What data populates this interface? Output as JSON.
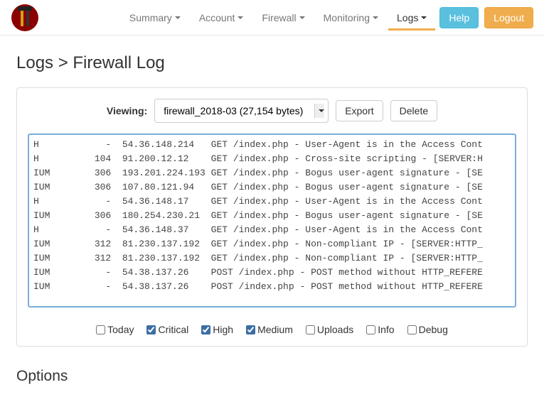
{
  "nav": {
    "items": [
      "Summary",
      "Account",
      "Firewall",
      "Monitoring",
      "Logs"
    ],
    "activeIndex": 4,
    "help": "Help",
    "logout": "Logout"
  },
  "page": {
    "title": "Logs > Firewall Log",
    "viewingLabel": "Viewing:",
    "selectedFile": "firewall_2018-03 (27,154 bytes)",
    "exportLabel": "Export",
    "deleteLabel": "Delete",
    "optionsHeading": "Options"
  },
  "log": {
    "lines": [
      "H            -  54.36.148.214   GET /index.php - User-Agent is in the Access Cont",
      "H          104  91.200.12.12    GET /index.php - Cross-site scripting - [SERVER:H",
      "IUM        306  193.201.224.193 GET /index.php - Bogus user-agent signature - [SE",
      "IUM        306  107.80.121.94   GET /index.php - Bogus user-agent signature - [SE",
      "H            -  54.36.148.17    GET /index.php - User-Agent is in the Access Cont",
      "IUM        306  180.254.230.21  GET /index.php - Bogus user-agent signature - [SE",
      "H            -  54.36.148.37    GET /index.php - User-Agent is in the Access Cont",
      "IUM        312  81.230.137.192  GET /index.php - Non-compliant IP - [SERVER:HTTP_",
      "IUM        312  81.230.137.192  GET /index.php - Non-compliant IP - [SERVER:HTTP_",
      "IUM          -  54.38.137.26    POST /index.php - POST method without HTTP_REFERE",
      "IUM          -  54.38.137.26    POST /index.php - POST method without HTTP_REFERE"
    ]
  },
  "filters": [
    {
      "label": "Today",
      "checked": false
    },
    {
      "label": "Critical",
      "checked": true
    },
    {
      "label": "High",
      "checked": true
    },
    {
      "label": "Medium",
      "checked": true
    },
    {
      "label": "Uploads",
      "checked": false
    },
    {
      "label": "Info",
      "checked": false
    },
    {
      "label": "Debug",
      "checked": false
    }
  ]
}
